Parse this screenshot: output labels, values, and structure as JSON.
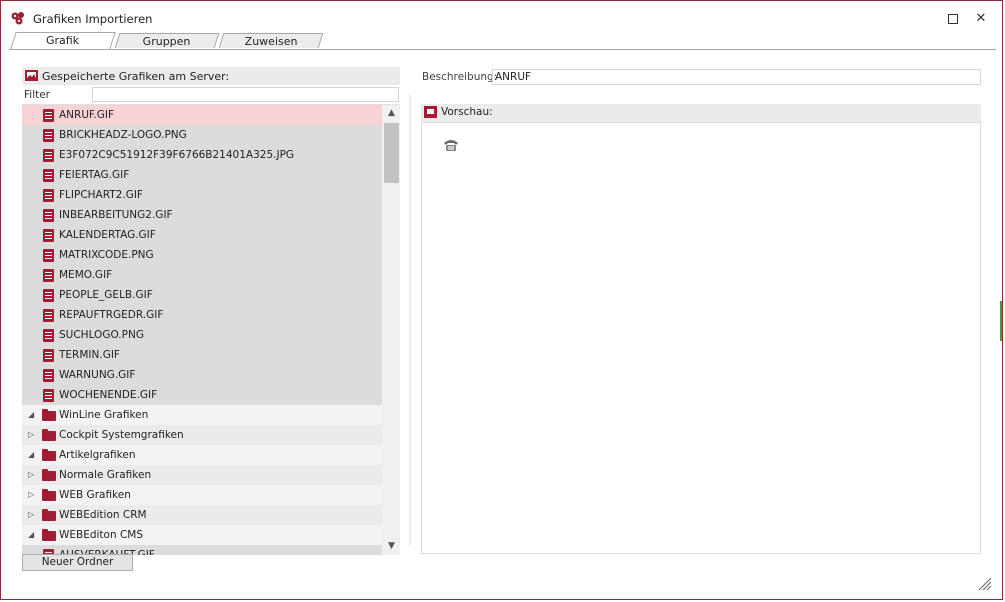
{
  "window": {
    "title": "Grafiken Importieren",
    "maximize_icon": "maximize-icon",
    "close_icon": "close-icon",
    "close_glyph": "✕"
  },
  "tabs": [
    {
      "label": "Grafik",
      "active": true
    },
    {
      "label": "Gruppen",
      "active": false
    },
    {
      "label": "Zuweisen",
      "active": false
    }
  ],
  "left_panel": {
    "header": "Gespeicherte Grafiken am Server:",
    "filter_label": "Filter",
    "filter_value": "",
    "items": [
      {
        "label": "ANRUF.GIF",
        "type": "file",
        "selected": true
      },
      {
        "label": "BRICKHEADZ-LOGO.PNG",
        "type": "file"
      },
      {
        "label": "E3F072C9C51912F39F6766B21401A325.JPG",
        "type": "file"
      },
      {
        "label": "FEIERTAG.GIF",
        "type": "file"
      },
      {
        "label": "FLIPCHART2.GIF",
        "type": "file"
      },
      {
        "label": "INBEARBEITUNG2.GIF",
        "type": "file"
      },
      {
        "label": "KALENDERTAG.GIF",
        "type": "file"
      },
      {
        "label": "MATRIXCODE.PNG",
        "type": "file"
      },
      {
        "label": "MEMO.GIF",
        "type": "file"
      },
      {
        "label": "PEOPLE_GELB.GIF",
        "type": "file"
      },
      {
        "label": "REPAUFTRGEDR.GIF",
        "type": "file"
      },
      {
        "label": "SUCHLOGO.PNG",
        "type": "file"
      },
      {
        "label": "TERMIN.GIF",
        "type": "file"
      },
      {
        "label": "WARNUNG.GIF",
        "type": "file"
      },
      {
        "label": "WOCHENENDE.GIF",
        "type": "file"
      },
      {
        "label": "WinLine Grafiken",
        "type": "root",
        "expanded": true
      },
      {
        "label": "Cockpit Systemgrafiken",
        "type": "folder",
        "expanded": false
      },
      {
        "label": "Artikelgrafiken",
        "type": "folder",
        "expanded": true
      },
      {
        "label": "Normale Grafiken",
        "type": "folder",
        "expanded": false
      },
      {
        "label": "WEB Grafiken",
        "type": "folder",
        "expanded": false
      },
      {
        "label": "WEBEdition CRM",
        "type": "folder",
        "expanded": false
      },
      {
        "label": "WEBEditon CMS",
        "type": "folder",
        "expanded": true
      },
      {
        "label": "AUSVERKAUFT.GIF",
        "type": "file"
      }
    ],
    "new_folder_button": "Neuer Ordner"
  },
  "right_panel": {
    "description_label": "Beschreibung:",
    "description_value": "ANRUF",
    "preview_header": "Vorschau:",
    "preview_icon": "telephone-icon"
  },
  "colors": {
    "accent": "#a11d33",
    "selected_row": "#f7d3d5",
    "border": "#8b2a3a"
  }
}
